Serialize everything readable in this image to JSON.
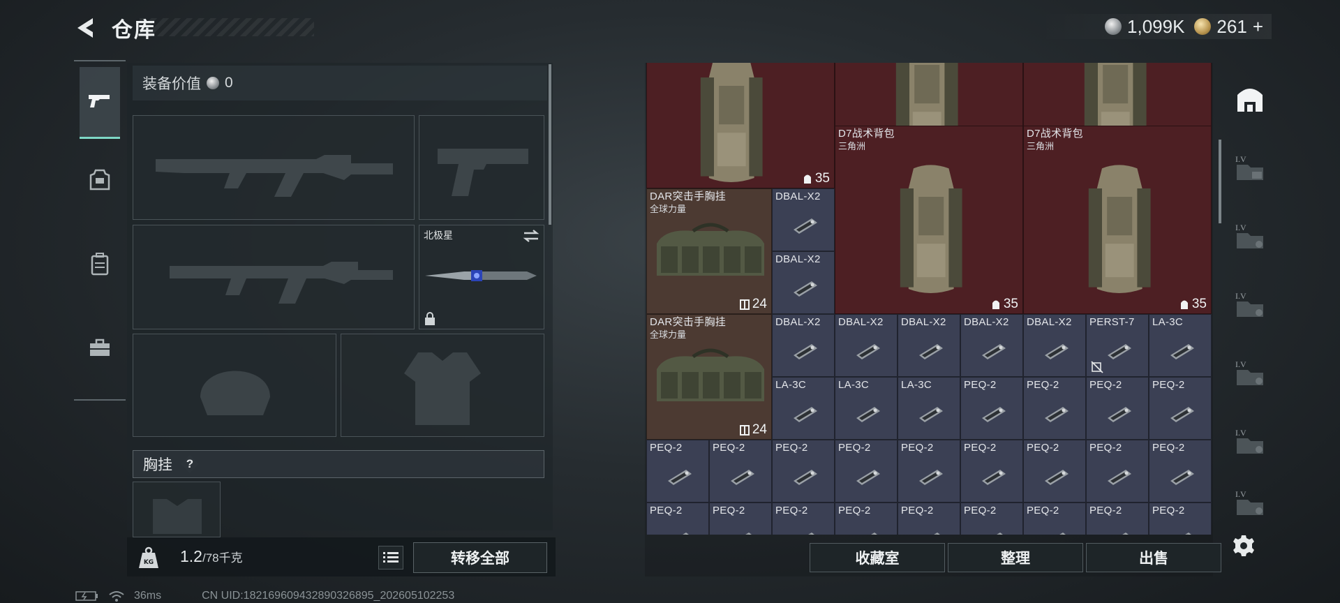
{
  "header": {
    "title": "仓库",
    "currency": {
      "coins": "1,099K",
      "tokens": "261",
      "plus": "+"
    }
  },
  "equipment": {
    "value_label": "装备价值",
    "value": "0",
    "melee_name": "北极星",
    "rig_label": "胸挂",
    "rig_help": "?"
  },
  "weight": {
    "current": "1.2",
    "max": "/78千克"
  },
  "actions": {
    "transfer_all": "转移全部",
    "collection_room": "收藏室",
    "organize": "整理",
    "sell": "出售"
  },
  "status": {
    "ping": "36ms",
    "uid": "CN UID:182169609432890326895_202605102253"
  },
  "stash": {
    "backpack_count": "35",
    "d7_name": "D7战术背包",
    "d7_brand": "三角洲",
    "dar_name": "DAR突击手胸挂",
    "dar_brand": "全球力量",
    "dar_count": "24",
    "attachments": [
      "DBAL-X2",
      "PERST-7",
      "LA-3C",
      "PEQ-2"
    ]
  },
  "colors": {
    "accent": "#7ed8c6",
    "backpack_bg": "#4d1f23",
    "rig_bg": "#4c3a32",
    "attachment_bg": "#3b4054"
  }
}
